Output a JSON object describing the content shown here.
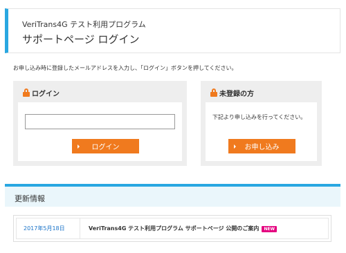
{
  "header": {
    "app_name": "VeriTrans4G テスト利用プログラム",
    "page_title": "サポートページ ログイン",
    "accent_color": "#29a7e1"
  },
  "instruction": "お申し込み時に登録したメールアドレスを入力し、「ログイン」ボタンを押してください。",
  "login_panel": {
    "heading": "ログイン",
    "heading_icon": "lock-icon",
    "email_input": {
      "value": "",
      "placeholder": ""
    },
    "button_label": "ログイン"
  },
  "register_panel": {
    "heading": "未登録の方",
    "heading_icon": "lock-icon",
    "text": "下記より申し込みを行ってください。",
    "button_label": "お申し込み"
  },
  "news": {
    "heading": "更新情報",
    "items": [
      {
        "date": "2017年5月18日",
        "title": "VeriTrans4G テスト利用プログラム サポートページ 公開のご案内",
        "badge": "NEW"
      }
    ]
  },
  "colors": {
    "button": "#f07a1e",
    "badge": "#e4007f",
    "link": "#1a73c8"
  }
}
